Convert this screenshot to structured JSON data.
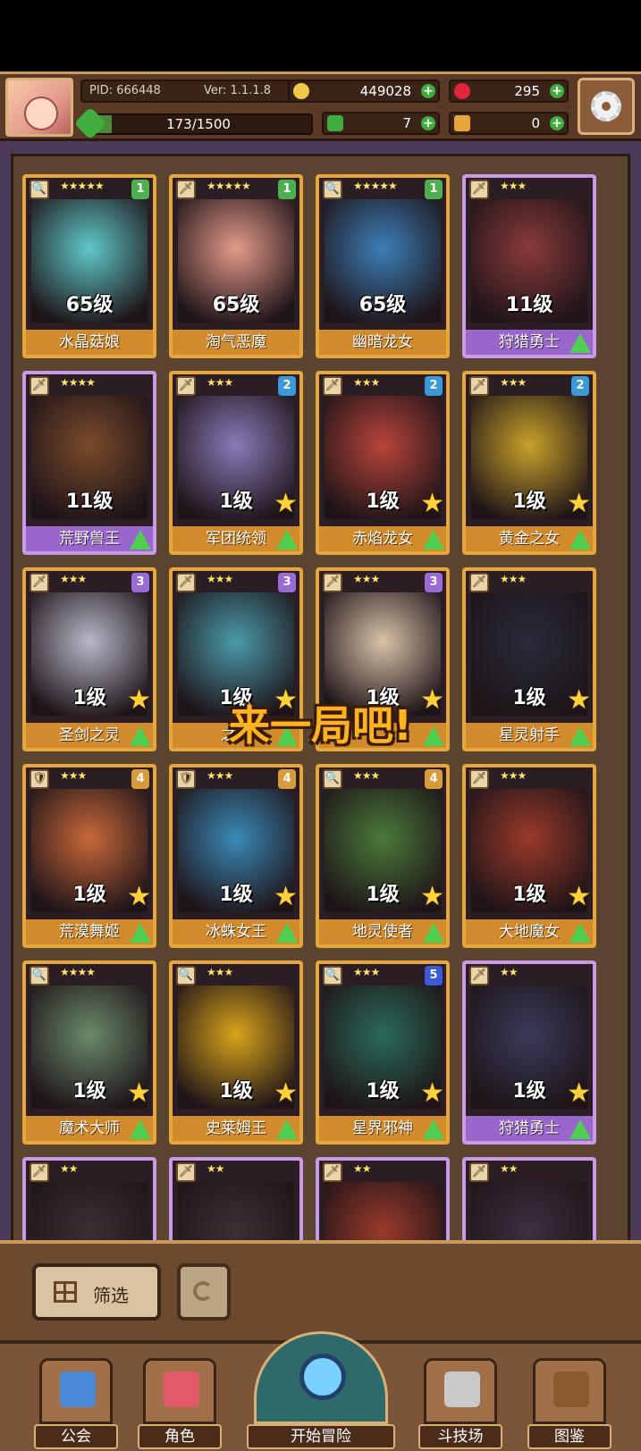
{
  "header": {
    "pid_label": "PID: 666448",
    "version_label": "Ver: 1.1.1.8",
    "gold": "449028",
    "gems": "295",
    "energy": "173/1500",
    "energy_fraction": 0.115,
    "clover": "7",
    "keys": "0",
    "plus_symbol": "+"
  },
  "overlay_text": "来一局吧!",
  "cards": [
    {
      "stars": "★★★★★",
      "tier": "1",
      "level": "65级",
      "name": "水晶菇娘",
      "frame": "gold",
      "role": "🔍",
      "color": "#5fc9c9"
    },
    {
      "stars": "★★★★★",
      "tier": "1",
      "level": "65级",
      "name": "淘气恶魔",
      "frame": "gold",
      "role": "🗡",
      "color": "#e59a8a"
    },
    {
      "stars": "★★★★★",
      "tier": "1",
      "level": "65级",
      "name": "幽暗龙女",
      "frame": "gold",
      "role": "🔍",
      "color": "#3c7fb8"
    },
    {
      "stars": "★★★",
      "tier": "",
      "level": "11级",
      "name": "狩猎勇士",
      "frame": "purple",
      "role": "🗡",
      "color": "#8a3a3a"
    },
    {
      "stars": "★★★★",
      "tier": "",
      "level": "11级",
      "name": "荒野兽王",
      "frame": "purple",
      "role": "🗡",
      "color": "#7a4a2a"
    },
    {
      "stars": "★★★",
      "tier": "2",
      "level": "1级",
      "name": "军团统领",
      "frame": "gold",
      "role": "🗡",
      "color": "#8a7ab8"
    },
    {
      "stars": "★★★",
      "tier": "2",
      "level": "1级",
      "name": "赤焰龙女",
      "frame": "gold",
      "role": "🗡",
      "color": "#b8443a"
    },
    {
      "stars": "★★★",
      "tier": "2",
      "level": "1级",
      "name": "黄金之女",
      "frame": "gold",
      "role": "🗡",
      "color": "#c9a22a"
    },
    {
      "stars": "★★★",
      "tier": "3",
      "level": "1级",
      "name": "圣剑之灵",
      "frame": "gold",
      "role": "🗡",
      "color": "#b8b8c9"
    },
    {
      "stars": "★★★",
      "tier": "3",
      "level": "1级",
      "name": "之灵",
      "frame": "gold",
      "role": "🗡",
      "color": "#4a9aaa"
    },
    {
      "stars": "★★★",
      "tier": "3",
      "level": "1级",
      "name": "",
      "frame": "gold",
      "role": "🗡",
      "color": "#d9c2a8"
    },
    {
      "stars": "★★★",
      "tier": "",
      "level": "1级",
      "name": "星灵射手",
      "frame": "gold",
      "role": "🗡",
      "color": "#2a2a3a"
    },
    {
      "stars": "★★★",
      "tier": "4",
      "level": "1级",
      "name": "荒漠舞姬",
      "frame": "gold",
      "role": "🛡",
      "color": "#c9683a"
    },
    {
      "stars": "★★★",
      "tier": "4",
      "level": "1级",
      "name": "冰蛛女王",
      "frame": "gold",
      "role": "🛡",
      "color": "#3a8ab8"
    },
    {
      "stars": "★★★",
      "tier": "4",
      "level": "1级",
      "name": "地灵使者",
      "frame": "gold",
      "role": "🔍",
      "color": "#4a7a3a"
    },
    {
      "stars": "★★★",
      "tier": "",
      "level": "1级",
      "name": "大地魔女",
      "frame": "gold",
      "role": "🗡",
      "color": "#9a3a2a"
    },
    {
      "stars": "★★★★",
      "tier": "",
      "level": "1级",
      "name": "魔术大师",
      "frame": "gold",
      "role": "🔍",
      "color": "#6a8a6a"
    },
    {
      "stars": "★★★",
      "tier": "",
      "level": "1级",
      "name": "史莱姆王",
      "frame": "gold",
      "role": "🔍",
      "color": "#d9a41a"
    },
    {
      "stars": "★★★",
      "tier": "5",
      "level": "1级",
      "name": "星界邪神",
      "frame": "gold",
      "role": "🔍",
      "color": "#2a6a5a"
    },
    {
      "stars": "★★",
      "tier": "",
      "level": "1级",
      "name": "狩猎勇士",
      "frame": "purple",
      "role": "🗡",
      "color": "#3a3a5a"
    },
    {
      "stars": "★★",
      "tier": "",
      "level": "",
      "name": "",
      "frame": "purple",
      "role": "🗡",
      "color": "#3a3030"
    },
    {
      "stars": "★★",
      "tier": "",
      "level": "",
      "name": "",
      "frame": "purple",
      "role": "🗡",
      "color": "#3a3030"
    },
    {
      "stars": "★★",
      "tier": "",
      "level": "",
      "name": "",
      "frame": "purple",
      "role": "🗡",
      "color": "#9a3a2a"
    },
    {
      "stars": "★★",
      "tier": "",
      "level": "",
      "name": "",
      "frame": "purple",
      "role": "🗡",
      "color": "#3a3040"
    }
  ],
  "tier_colors": {
    "1": "#4caf50",
    "2": "#3a9ad9",
    "3": "#9a6ad9",
    "4": "#d99a3a",
    "5": "#3a5ad9"
  },
  "controls": {
    "filter_label": "筛选"
  },
  "nav": [
    {
      "label": "公会",
      "color": "#4a8ad9"
    },
    {
      "label": "角色",
      "color": "#e25a6a"
    },
    {
      "label": "开始冒险",
      "color": "#7ad0ff"
    },
    {
      "label": "斗技场",
      "color": "#c9c9c9"
    },
    {
      "label": "图鉴",
      "color": "#8a5a2a"
    }
  ]
}
